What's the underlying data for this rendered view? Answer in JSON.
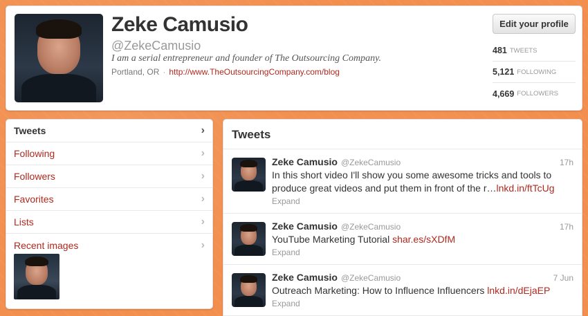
{
  "profile": {
    "name": "Zeke Camusio",
    "handle": "@ZekeCamusio",
    "bio": "I am a serial entrepreneur and founder of The Outsourcing Company.",
    "location": "Portland, OR",
    "separator": "·",
    "url": "http://www.TheOutsourcingCompany.com/blog",
    "edit_button": "Edit your profile",
    "stats": [
      {
        "value": "481",
        "label": "TWEETS"
      },
      {
        "value": "5,121",
        "label": "FOLLOWING"
      },
      {
        "value": "4,669",
        "label": "FOLLOWERS"
      }
    ]
  },
  "nav": {
    "items": [
      {
        "label": "Tweets",
        "active": true
      },
      {
        "label": "Following"
      },
      {
        "label": "Followers"
      },
      {
        "label": "Favorites"
      },
      {
        "label": "Lists"
      },
      {
        "label": "Recent images"
      }
    ],
    "chevron": "›"
  },
  "tweets": {
    "title": "Tweets",
    "items": [
      {
        "name": "Zeke Camusio",
        "handle": "@ZekeCamusio",
        "time": "17h",
        "text": "In this short video I'll show you some awesome tricks and tools to produce great videos and put them in front of the r…",
        "link": "lnkd.in/ftTcUg",
        "expand": "Expand"
      },
      {
        "name": "Zeke Camusio",
        "handle": "@ZekeCamusio",
        "time": "17h",
        "text": "YouTube Marketing Tutorial",
        "link": "shar.es/sXDfM",
        "expand": "Expand"
      },
      {
        "name": "Zeke Camusio",
        "handle": "@ZekeCamusio",
        "time": "7 Jun",
        "text": "Outreach Marketing: How to Influence Influencers",
        "link": "lnkd.in/dEjaEP",
        "expand": "Expand"
      }
    ]
  },
  "colors": {
    "background": "#f28f4f",
    "link": "#b0291f"
  }
}
